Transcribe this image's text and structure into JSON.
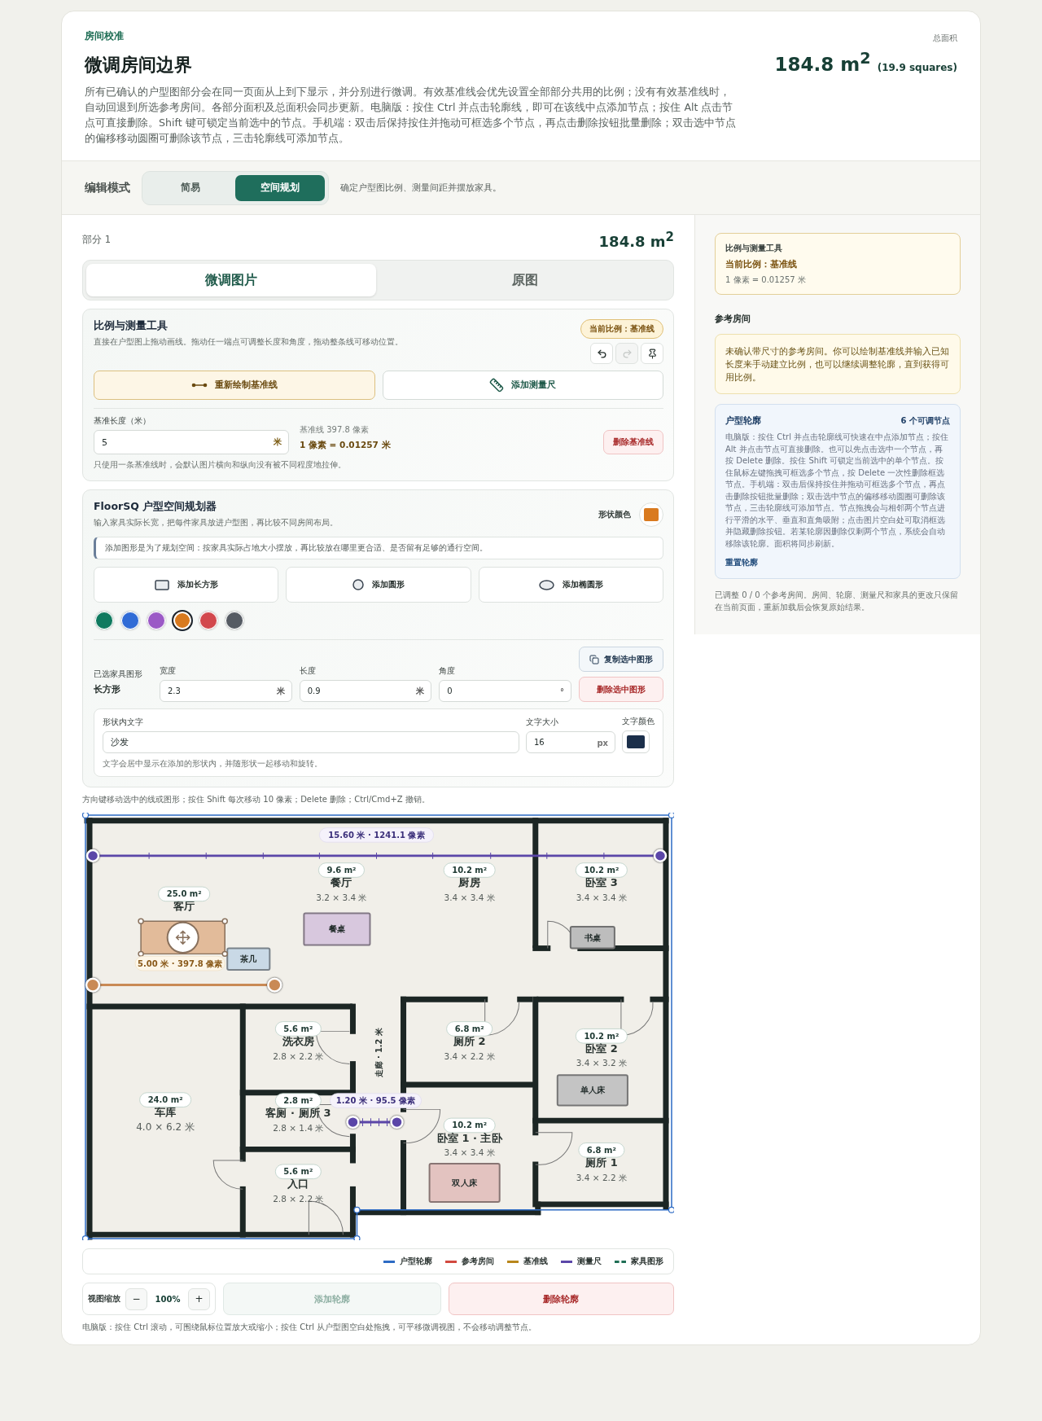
{
  "header": {
    "eyebrow": "房间校准",
    "title": "微调房间边界",
    "description": "所有已确认的户型图部分会在同一页面从上到下显示，并分别进行微调。有效基准线会优先设置全部部分共用的比例；没有有效基准线时，自动回退到所选参考房间。各部分面积及总面积会同步更新。电脑版：按住 Ctrl 并点击轮廓线，即可在该线中点添加节点；按住 Alt 点击节点可直接删除。Shift 键可锁定当前选中的节点。手机端：双击后保持按住并拖动可框选多个节点，再点击删除按钮批量删除；双击选中节点的偏移移动圆圈可删除该节点，三击轮廓线可添加节点。",
    "total_label": "总面积",
    "total_area": "184.8 m$^{2}$",
    "total_squares": "(19.9 squares)"
  },
  "mode": {
    "label": "编辑模式",
    "options": [
      {
        "label": "简易",
        "selected": false
      },
      {
        "label": "空间规划",
        "selected": true
      }
    ],
    "hint": "确定户型图比例、测量间距并摆放家具。"
  },
  "part": {
    "label": "部分 1",
    "area": "184.8 m$^{2}$"
  },
  "view_tabs": [
    {
      "label": "微调图片",
      "selected": true
    },
    {
      "label": "原图",
      "selected": false
    }
  ],
  "scale_tool": {
    "title": "比例与测量工具",
    "subtitle": "直接在户型图上拖动画线。拖动任一端点可调整长度和角度，拖动整条线可移动位置。",
    "badge": "当前比例：基准线",
    "tools": [
      {
        "kind": "undo",
        "disabled": false
      },
      {
        "kind": "redo",
        "disabled": true
      },
      {
        "kind": "pin",
        "disabled": false
      }
    ],
    "redraw_button": "重新绘制基准线",
    "ruler_button": "添加测量尺",
    "length_label": "基准长度（米）",
    "length_value": "5",
    "length_unit": "米",
    "baseline_pixels": "基准线 397.8 像素",
    "ratio": "1 像素 = 0.01257 米",
    "delete_button": "删除基准线",
    "note": "只使用一条基准线时，会默认图片横向和纵向没有被不同程度地拉伸。"
  },
  "planner": {
    "title": "FloorSQ 户型空间规划器",
    "subtitle": "输入家具实际长宽，把每件家具放进户型图，再比较不同房间布局。",
    "color_label": "形状颜色",
    "color": "#d97a1f",
    "notice": "添加图形是为了规划空间：按家具实际占地大小摆放，再比较放在哪里更合适、是否留有足够的通行空间。",
    "add_buttons": [
      {
        "kind": "rect",
        "label": "添加长方形"
      },
      {
        "kind": "circle",
        "label": "添加圆形"
      },
      {
        "kind": "ellipse",
        "label": "添加椭圆形"
      }
    ],
    "swatches": [
      {
        "color": "#0f7a5f",
        "selected": false
      },
      {
        "color": "#2f6bd6",
        "selected": false
      },
      {
        "color": "#9b59c6",
        "selected": false
      },
      {
        "color": "#d97a1f",
        "selected": true
      },
      {
        "color": "#d2474c",
        "selected": false
      },
      {
        "color": "#555b63",
        "selected": false
      }
    ],
    "selected_label": "已选家具图形",
    "selected_shape": "长方形",
    "fields": [
      {
        "label": "宽度",
        "value": "2.3",
        "unit": "米"
      },
      {
        "label": "长度",
        "value": "0.9",
        "unit": "米"
      },
      {
        "label": "角度",
        "value": "0",
        "unit": "°"
      }
    ],
    "copy_button": "复制选中图形",
    "delete_button": "删除选中图形",
    "text_label": "形状内文字",
    "text_value": "沙发",
    "size_label": "文字大小",
    "size_value": "16",
    "size_unit": "px",
    "text_color_label": "文字颜色",
    "text_swatch": {
      "color": "#1b2f4a"
    },
    "text_note": "文字会居中显示在添加的形状内，并随形状一起移动和旋转。"
  },
  "keyboard_hint": "方向键移动选中的线或图形；按住 Shift 每次移动 10 像素；Delete 删除；Ctrl/Cmd+Z 撤销。",
  "plan": {
    "measure_label": "15.60 米 · 1241.1 像素",
    "baseline_label": "5.00 米 · 397.8 像素",
    "small_measure_label": "1.20 米 · 95.5 像素",
    "corridor": "走廊 · 1.2 米",
    "rooms": [
      {
        "area": "9.6 m²",
        "name": "餐厅",
        "dims": "3.2 × 3.4 米"
      },
      {
        "area": "10.2 m²",
        "name": "厨房",
        "dims": "3.4 × 3.4 米"
      },
      {
        "area": "10.2 m²",
        "name": "卧室 3",
        "dims": "3.4 × 3.4 米"
      },
      {
        "area": "25.0 m²",
        "name": "客厅"
      },
      {
        "area": "5.6 m²",
        "name": "洗衣房",
        "dims": "2.8 × 2.2 米"
      },
      {
        "area": "24.0 m²",
        "name": "车库",
        "dims": "4.0 × 6.2 米"
      },
      {
        "area": "2.8 m²",
        "name": "客厕 · 厕所 3",
        "dims": "2.8 × 1.4 米"
      },
      {
        "area": "5.6 m²",
        "name": "入口",
        "dims": "2.8 × 2.2 米"
      },
      {
        "area": "6.8 m²",
        "name": "厕所 2",
        "dims": "3.4 × 2.2 米"
      },
      {
        "area": "10.2 m²",
        "name": "卧室 2",
        "dims": "3.4 × 3.2 米"
      },
      {
        "area": "10.2 m²",
        "name": "卧室 1 · 主卧",
        "dims": "3.4 × 3.4 米"
      },
      {
        "area": "6.8 m²",
        "name": "厕所 1",
        "dims": "3.4 × 2.2 米"
      }
    ],
    "furniture": [
      {
        "label": "餐桌",
        "color": "#d8c8de",
        "selected": false
      },
      {
        "label": "茶几",
        "color": "#c9d9e6",
        "selected": false
      },
      {
        "label": "书桌",
        "color": "#bdbdbd",
        "selected": false
      },
      {
        "label": "单人床",
        "color": "#c4c4c4",
        "selected": false
      },
      {
        "label": "双人床",
        "color": "#e3c3c0",
        "selected": false
      },
      {
        "color": "#e2bb9a",
        "selected": true
      }
    ]
  },
  "legend": [
    {
      "label": "户型轮廓",
      "color": "#2d6bc4",
      "kind": "solid"
    },
    {
      "label": "参考房间",
      "color": "#d2493f",
      "kind": "solid"
    },
    {
      "label": "基准线",
      "color": "#b8861b",
      "kind": "solid"
    },
    {
      "label": "测量尺",
      "color": "#5b46a8",
      "kind": "solid"
    },
    {
      "label": "家具图形",
      "color": "#1f6e55",
      "kind": "dashed"
    }
  ],
  "zoom": {
    "label": "视图缩放",
    "minus": "−",
    "value": "100%",
    "plus": "+"
  },
  "add_outline": {
    "label": "添加轮廓",
    "disabled": true
  },
  "delete_outline": "删除轮廓",
  "footer_hint": "电脑版：按住 Ctrl 滚动，可围绕鼠标位置放大或缩小；按住 Ctrl 从户型图空白处拖拽，可平移微调视图，不会移动调整节点。",
  "sidebar": {
    "scale_card": {
      "title": "比例与测量工具",
      "value": "当前比例：基准线",
      "ratio": "1 像素 = 0.01257 米"
    },
    "ref_title": "参考房间",
    "ref_notice": "未确认带尺寸的参考房间。你可以绘制基准线并输入已知长度来手动建立比例，也可以继续调整轮廓，直到获得可用比例。",
    "outline": {
      "title": "户型轮廓",
      "count": "6 个可调节点",
      "text": "电脑版：按住 Ctrl 并点击轮廓线可快速在中点添加节点；按住 Alt 并点击节点可直接删除。也可以先点击选中一个节点，再按 Delete 删除。按住 Shift 可锁定当前选中的单个节点。按住鼠标左键拖拽可框选多个节点，按 Delete 一次性删除框选节点。手机端：双击后保持按住并拖动可框选多个节点，再点击删除按钮批量删除；双击选中节点的偏移移动圆圈可删除该节点，三击轮廓线可添加节点。节点拖拽会与相邻两个节点进行平滑的水平、垂直和直角吸附；点击图片空白处可取消框选并隐藏删除按钮。若某轮廓因删除仅剩两个节点，系统会自动移除该轮廓。面积将同步刷新。",
      "reset": "重置轮廓"
    },
    "footer": "已调整 0 / 0 个参考房间。房间、轮廓、测量尺和家具的更改只保留在当前页面，重新加载后会恢复原始结果。"
  }
}
